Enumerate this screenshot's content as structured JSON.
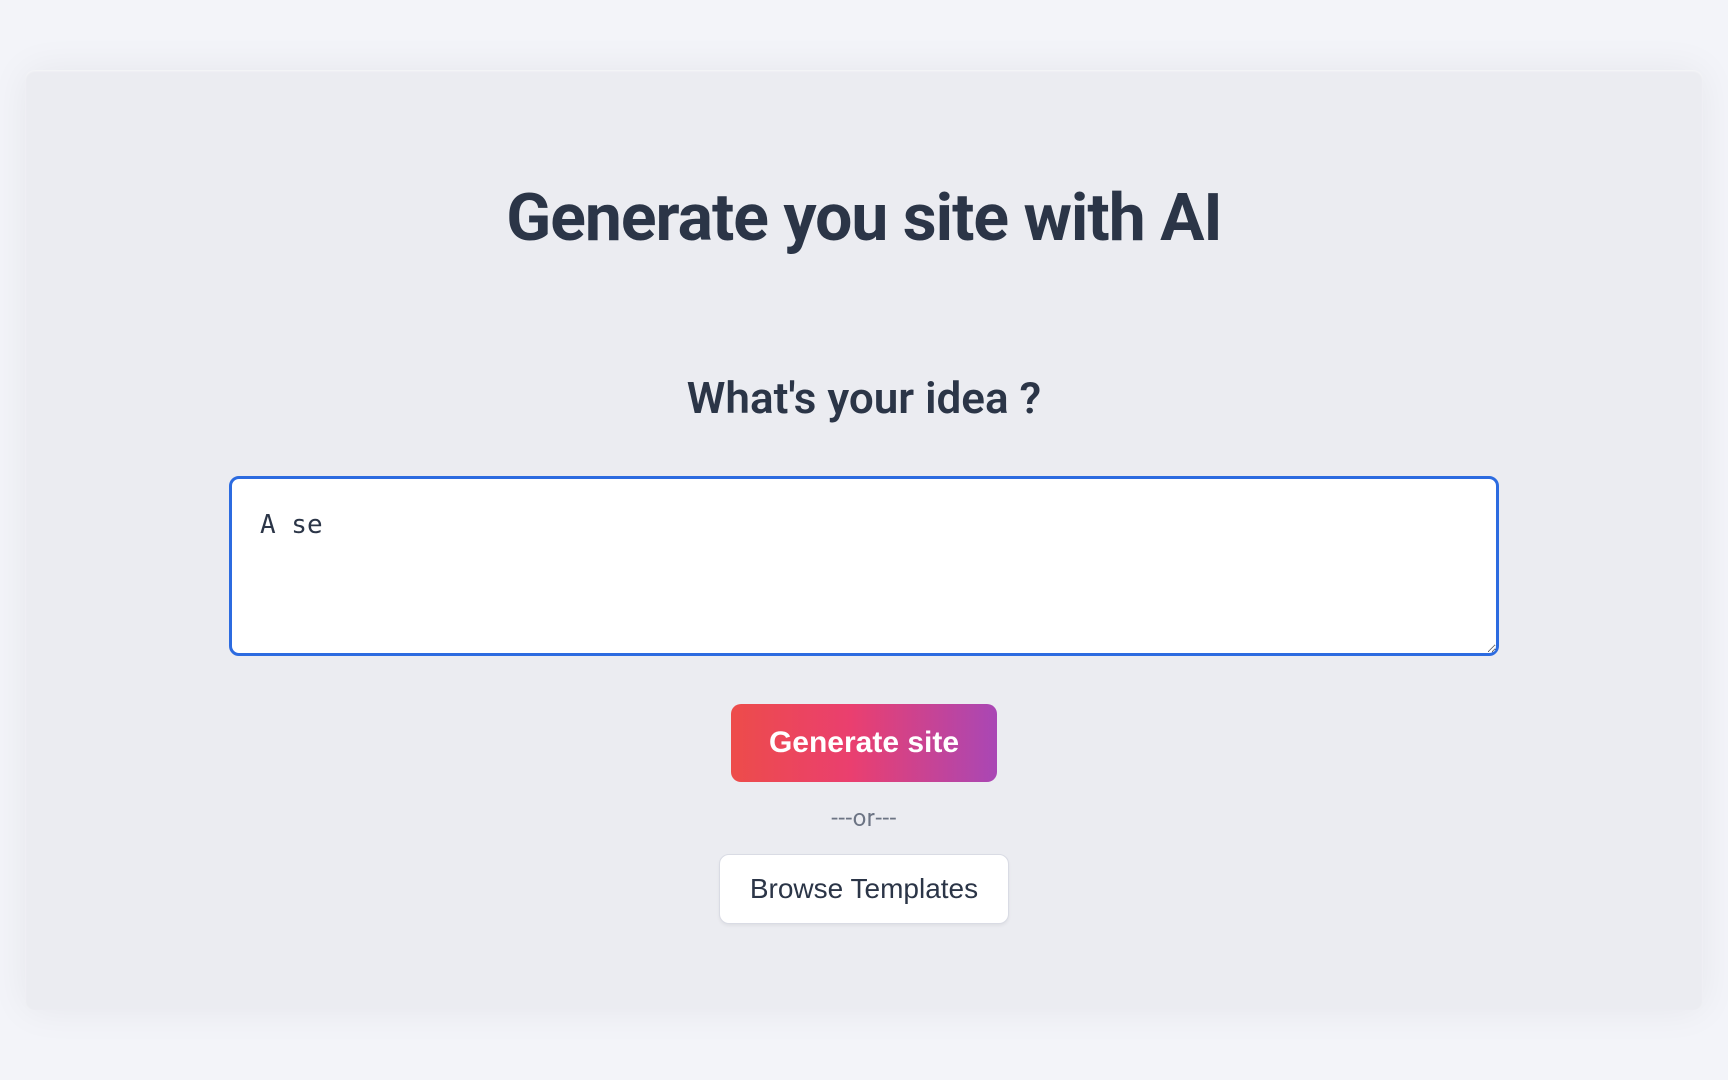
{
  "main": {
    "title": "Generate you site with AI",
    "subtitle": "What's your idea ?",
    "idea_value": "A se",
    "generate_label": "Generate site",
    "or_separator": "---or---",
    "browse_label": "Browse Templates"
  }
}
